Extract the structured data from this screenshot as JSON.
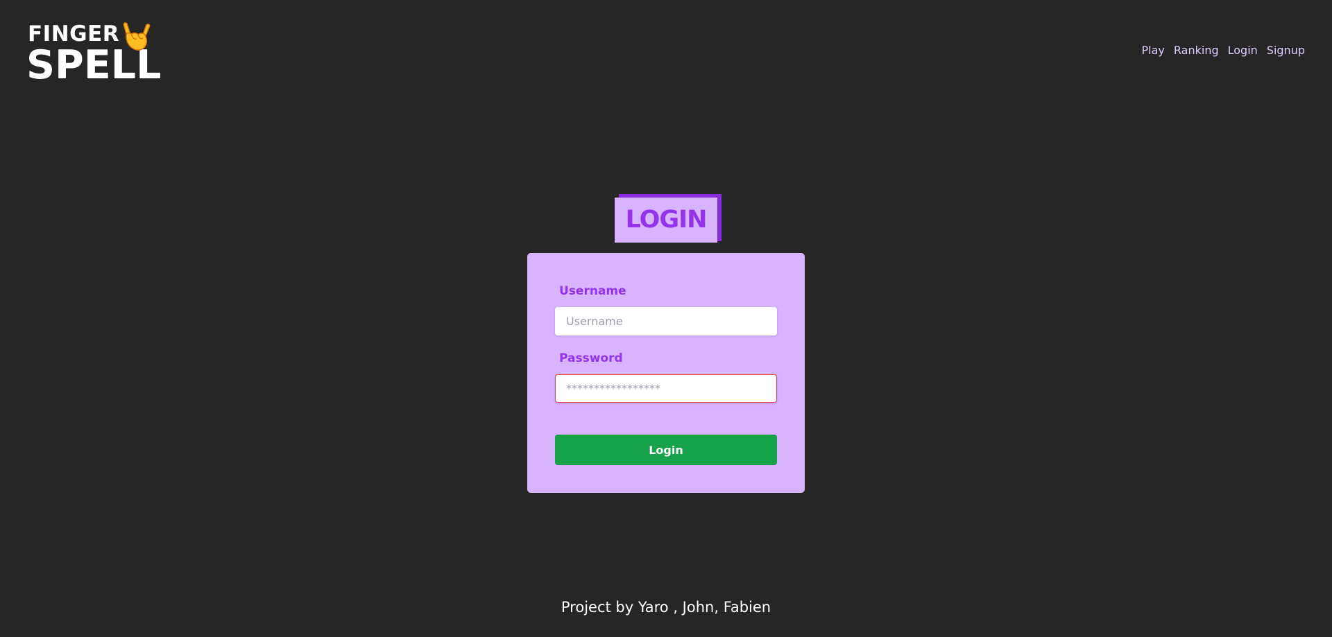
{
  "logo": {
    "line1": "FINGER",
    "line2": "SPELL",
    "icon": "hand-sign-icon"
  },
  "nav": {
    "items": [
      "Play",
      "Ranking",
      "Login",
      "Signup"
    ]
  },
  "title": "LOGIN",
  "form": {
    "username_label": "Username",
    "username_placeholder": "Username",
    "password_label": "Password",
    "password_placeholder": "*****************",
    "submit_label": "Login"
  },
  "footer": "Project by Yaro , John, Fabien",
  "colors": {
    "background": "#262626",
    "card": "#d8b4fe",
    "accent": "#9333ea",
    "button": "#16a34a",
    "nav_text": "#e0ccff",
    "error_border": "#ef4444"
  }
}
